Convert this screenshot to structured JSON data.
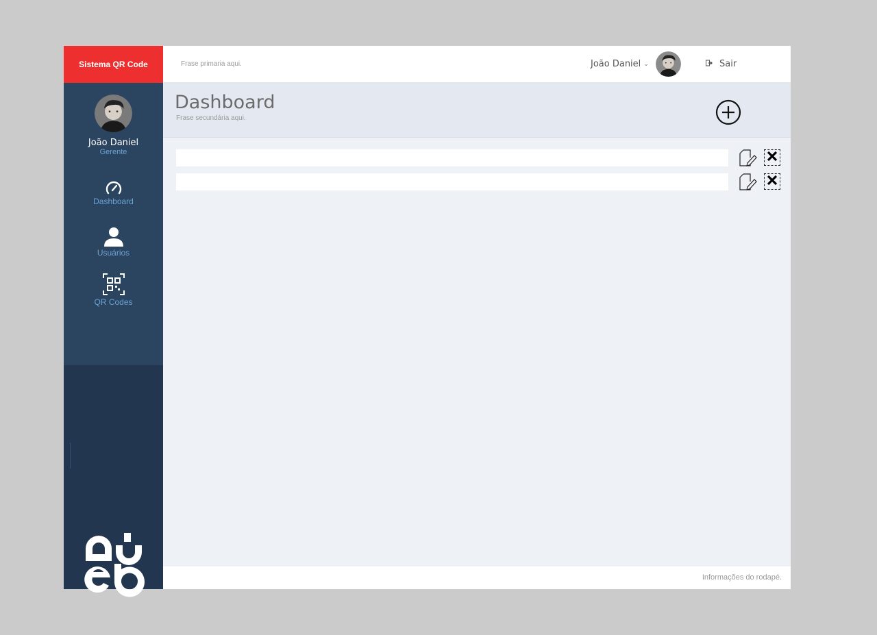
{
  "brand": {
    "title": "Sistema QR Code"
  },
  "topbar": {
    "phrase": "Frase primaria aqui.",
    "user_name": "João Daniel",
    "caret": "⌄",
    "logout_label": "Sair"
  },
  "sidebar": {
    "user_name": "João Daniel",
    "user_role": "Gerente",
    "items": [
      {
        "label": "Dashboard",
        "icon": "speedometer-icon"
      },
      {
        "label": "Usuários",
        "icon": "user-icon"
      },
      {
        "label": "QR Codes",
        "icon": "qr-code-icon"
      }
    ]
  },
  "header": {
    "title": "Dashboard",
    "subtitle": "Frase secundária aqui."
  },
  "footer": {
    "text": "Informações do rodapé."
  },
  "colors": {
    "brand": "#ee2f2f",
    "sidebar": "#2b4460",
    "sidebar_dark": "#223650",
    "accent": "#6aa3d4"
  }
}
